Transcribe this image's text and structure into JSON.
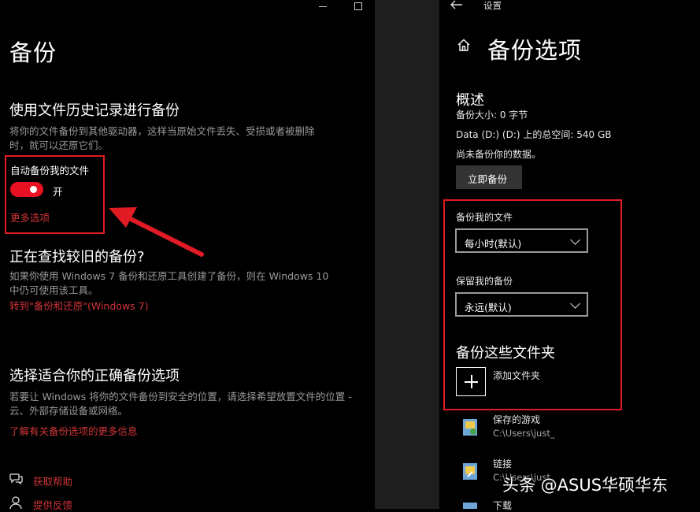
{
  "left": {
    "page_title": "备份",
    "section1": {
      "heading": "使用文件历史记录进行备份",
      "desc_line1": "将你的文件备份到其他驱动器，这样当原始文件丢失、受损或者被删除",
      "desc_line2": "时，就可以还原它们。",
      "auto_backup_label": "自动备份我的文件",
      "toggle_state": "开",
      "more_options": "更多选项"
    },
    "section2": {
      "heading": "正在查找较旧的备份?",
      "desc_line1": "如果你使用 Windows 7 备份和还原工具创建了备份，则在 Windows 10",
      "desc_line2": "中仍可使用该工具。",
      "link": "转到\"备份和还原\"(Windows 7)"
    },
    "section3": {
      "heading": "选择适合你的正确备份选项",
      "desc_line1": "若要让 Windows 将你的文件备份到安全的位置，请选择希望放置文件的位置 -",
      "desc_line2": "云、外部存储设备或网络。",
      "link": "了解有关备份选项的更多信息"
    },
    "footer": {
      "help": "获取帮助",
      "feedback": "提供反馈"
    }
  },
  "right": {
    "window_title": "设置",
    "page_title": "备份选项",
    "overview": {
      "heading": "概述",
      "backup_size": "备份大小: 0 字节",
      "total_space": "Data (D:) (D:) 上的总空间: 540 GB",
      "status": "尚未备份你的数据。",
      "backup_now": "立即备份"
    },
    "backup_files_label": "备份我的文件",
    "backup_files_value": "每小时(默认)",
    "keep_backups_label": "保留我的备份",
    "keep_backups_value": "永远(默认)",
    "folders_heading": "备份这些文件夹",
    "add_folder": "添加文件夹",
    "folders": [
      {
        "name": "保存的游戏",
        "path": "C:\\Users\\just_"
      },
      {
        "name": "链接",
        "path": "C:\\Users\\just_"
      },
      {
        "name": "下载",
        "path": ""
      }
    ]
  },
  "watermark": "头条 @ASUS华硕华东",
  "colors": {
    "accent_red": "#e81123",
    "link_red": "#d13438",
    "annotation_red": "#e01b24"
  }
}
